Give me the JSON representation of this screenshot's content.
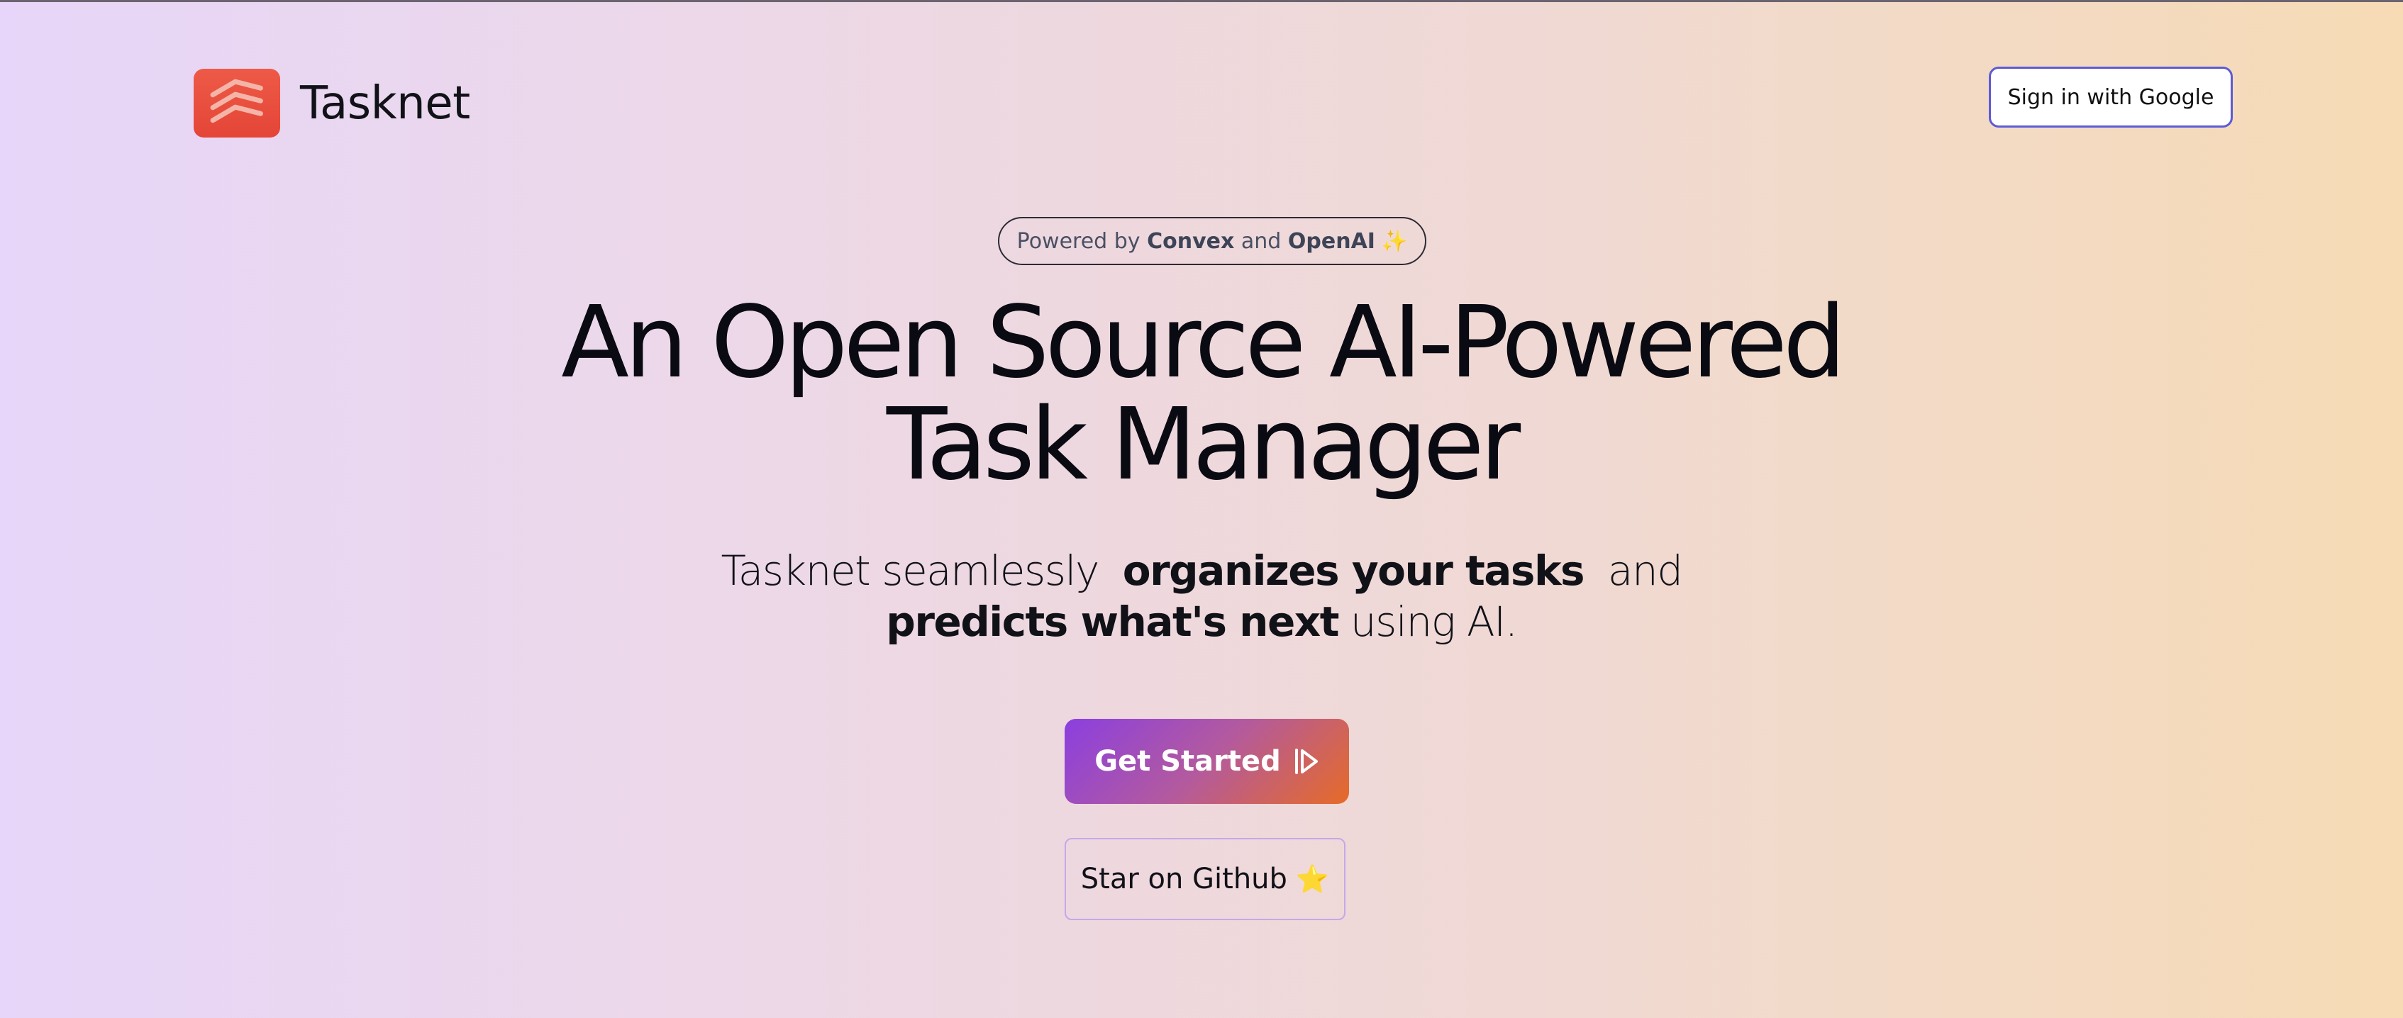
{
  "header": {
    "brand_name": "Tasknet",
    "logo_icon": "stacked-layers-icon",
    "signin_label": "Sign in with Google"
  },
  "badge": {
    "prefix": "Powered by",
    "first": "Convex",
    "joiner": "and",
    "second": "OpenAI",
    "emoji": "✨"
  },
  "hero": {
    "title_line1": "An Open Source AI-Powered",
    "title_line2": "Task Manager",
    "sub_part1": "Tasknet seamlessly",
    "sub_bold1": "organizes your tasks",
    "sub_part2": "and",
    "sub_bold2": "predicts what's next",
    "sub_part3": "using AI."
  },
  "actions": {
    "get_started_label": "Get Started",
    "get_started_icon": "play-forward-icon",
    "github_label": "Star on Github",
    "github_emoji": "⭐"
  },
  "colors": {
    "brand": "#e64a3b",
    "accent_border": "#5b5bd6",
    "cta_start": "#8b3fe0",
    "cta_end": "#e66b27"
  }
}
